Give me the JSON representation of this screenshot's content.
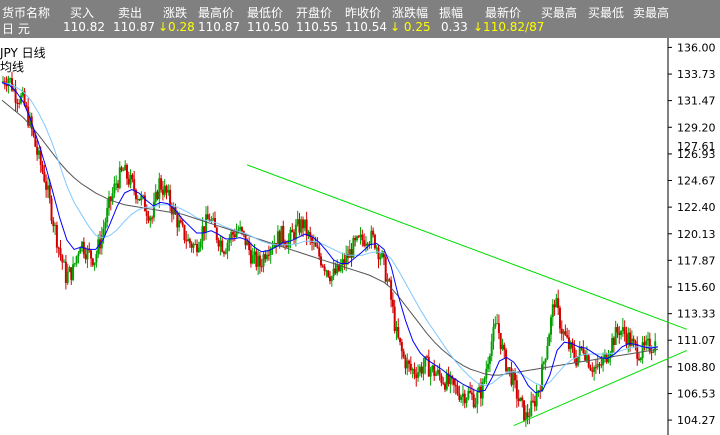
{
  "quote_header": {
    "columns": [
      "货币名称",
      "买入",
      "卖出",
      "涨跌",
      "最高价",
      "最低价",
      "开盘价",
      "昨收价",
      "涨跌幅",
      "振幅",
      "最新价",
      "买最高",
      "买最低",
      "卖最高"
    ]
  },
  "quote_values": {
    "currency": "日  元",
    "buy": "110.82",
    "sell": "110.87",
    "change": "↓0.28",
    "high": "110.87",
    "low": "110.50",
    "open": "110.55",
    "prev_close": "110.54",
    "change_pct": "↓  0.25",
    "amplitude": "0.33",
    "latest": "↓110.82/87"
  },
  "chart_labels": {
    "symbol_period": "JPY  日线",
    "series_label": "均线",
    "current_price_label": "127.61"
  },
  "colors": {
    "header_bg": "#808080",
    "header_text": "#ffffff",
    "down_text": "#ffff00",
    "bull_candle": "#00a000",
    "bear_candle": "#d00000",
    "ma_short": "#0000ff",
    "ma_mid": "#80c8ff",
    "ma_long": "#555555",
    "trendline": "#00e000"
  },
  "chart_data": {
    "type": "candlestick",
    "y_ticks": [
      "136.00",
      "133.73",
      "131.47",
      "129.20",
      "126.93",
      "124.67",
      "122.40",
      "120.13",
      "117.87",
      "115.60",
      "113.33",
      "111.07",
      "108.80",
      "106.53",
      "104.27"
    ],
    "ylim": [
      103.0,
      136.8
    ],
    "close_path": [
      133.0,
      133.5,
      132.0,
      131.5,
      129.5,
      127.0,
      125.0,
      122.0,
      119.0,
      116.5,
      117.0,
      119.5,
      118.5,
      118.0,
      120.0,
      122.5,
      124.5,
      125.5,
      124.5,
      123.5,
      122.5,
      121.5,
      124.5,
      123.5,
      122.0,
      120.5,
      119.5,
      119.0,
      120.5,
      121.5,
      120.0,
      119.0,
      120.0,
      120.5,
      119.5,
      118.0,
      117.5,
      119.0,
      119.5,
      120.0,
      119.5,
      120.5,
      121.0,
      119.5,
      118.5,
      117.5,
      116.5,
      117.0,
      118.0,
      119.0,
      119.5,
      120.0,
      119.5,
      118.0,
      115.5,
      111.5,
      109.5,
      108.5,
      108.5,
      109.0,
      108.5,
      108.0,
      107.5,
      107.0,
      106.5,
      106.5,
      106.0,
      107.0,
      110.5,
      112.5,
      109.5,
      108.0,
      106.0,
      104.5,
      105.5,
      107.5,
      111.0,
      114.5,
      112.0,
      110.5,
      109.5,
      110.5,
      109.0,
      108.5,
      109.5,
      111.0,
      112.0,
      111.5,
      110.5,
      110.0,
      110.5,
      110.8
    ],
    "ma_short": [
      133.0,
      132.8,
      132.2,
      131.3,
      129.8,
      128.0,
      126.0,
      123.8,
      121.5,
      119.6,
      118.8,
      119.0,
      118.8,
      118.8,
      119.6,
      121.0,
      122.5,
      123.6,
      123.9,
      123.6,
      123.0,
      122.5,
      122.8,
      122.7,
      122.2,
      121.4,
      120.8,
      120.2,
      120.2,
      120.4,
      120.1,
      119.7,
      119.7,
      119.8,
      119.6,
      119.0,
      118.6,
      118.7,
      119.0,
      119.4,
      119.5,
      119.8,
      120.1,
      119.9,
      119.4,
      118.7,
      117.9,
      117.6,
      117.6,
      118.1,
      118.6,
      119.2,
      119.3,
      118.8,
      117.3,
      114.8,
      112.7,
      111.0,
      110.0,
      109.4,
      109.0,
      108.6,
      108.1,
      107.7,
      107.3,
      107.0,
      106.7,
      106.8,
      107.9,
      109.3,
      109.6,
      109.2,
      108.3,
      107.2,
      106.6,
      106.8,
      108.1,
      110.2,
      110.9,
      110.8,
      110.5,
      110.4,
      110.0,
      109.6,
      109.5,
      109.9,
      110.5,
      110.8,
      110.7,
      110.5,
      110.4,
      110.5
    ],
    "ma_mid": [
      133.0,
      132.9,
      132.6,
      132.2,
      131.5,
      130.5,
      129.3,
      127.8,
      126.0,
      124.2,
      122.8,
      121.8,
      120.8,
      120.0,
      119.8,
      120.0,
      120.5,
      121.2,
      121.8,
      122.2,
      122.4,
      122.4,
      122.6,
      122.6,
      122.5,
      122.2,
      121.9,
      121.5,
      121.3,
      121.2,
      121.0,
      120.7,
      120.5,
      120.3,
      120.1,
      119.8,
      119.5,
      119.3,
      119.2,
      119.2,
      119.2,
      119.3,
      119.5,
      119.5,
      119.4,
      119.1,
      118.8,
      118.5,
      118.3,
      118.3,
      118.3,
      118.5,
      118.6,
      118.5,
      118.0,
      117.0,
      115.9,
      114.8,
      113.7,
      112.7,
      111.8,
      110.9,
      110.0,
      109.2,
      108.5,
      107.9,
      107.4,
      107.2,
      107.4,
      107.9,
      108.3,
      108.4,
      108.2,
      107.8,
      107.4,
      107.2,
      107.5,
      108.2,
      108.9,
      109.4,
      109.7,
      109.9,
      109.9,
      109.9,
      109.9,
      110.0,
      110.2,
      110.4,
      110.5,
      110.5,
      110.5,
      110.5
    ],
    "ma_long": [
      131.5,
      131.0,
      130.5,
      130.0,
      129.3,
      128.6,
      127.8,
      127.0,
      126.2,
      125.5,
      124.9,
      124.4,
      124.0,
      123.6,
      123.3,
      123.0,
      122.8,
      122.6,
      122.5,
      122.4,
      122.3,
      122.2,
      122.1,
      122.0,
      121.9,
      121.8,
      121.6,
      121.4,
      121.2,
      121.0,
      120.8,
      120.6,
      120.4,
      120.2,
      120.0,
      119.8,
      119.6,
      119.4,
      119.2,
      119.0,
      118.8,
      118.6,
      118.4,
      118.2,
      118.0,
      117.8,
      117.6,
      117.4,
      117.2,
      117.0,
      116.8,
      116.6,
      116.3,
      116.0,
      115.5,
      114.8,
      114.0,
      113.2,
      112.4,
      111.6,
      110.9,
      110.3,
      109.8,
      109.3,
      108.9,
      108.6,
      108.4,
      108.2,
      108.1,
      108.1,
      108.2,
      108.3,
      108.4,
      108.5,
      108.6,
      108.7,
      108.8,
      108.9,
      109.0,
      109.1,
      109.2,
      109.3,
      109.4,
      109.5,
      109.6,
      109.7,
      109.8,
      109.9,
      110.0,
      110.1,
      110.2,
      110.3
    ],
    "trendlines": [
      {
        "from": [
          34,
          126.0
        ],
        "to": [
          95,
          112.0
        ]
      },
      {
        "from": [
          71,
          103.8
        ],
        "to": [
          95,
          110.2
        ]
      }
    ]
  }
}
